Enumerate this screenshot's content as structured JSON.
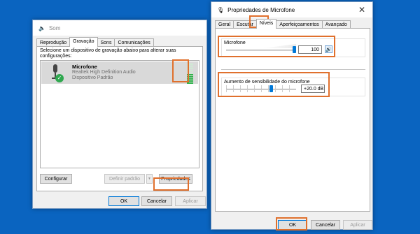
{
  "colors": {
    "desktop": "#0a64c0",
    "accent": "#0078d7",
    "highlight": "#e0702d",
    "meter_on": "#2fb34a"
  },
  "sound_window": {
    "title": "Som",
    "tabs": [
      {
        "label": "Reprodução"
      },
      {
        "label": "Gravação"
      },
      {
        "label": "Sons"
      },
      {
        "label": "Comunicações"
      }
    ],
    "selected_tab": "Gravação",
    "instruction": "Selecione um dispositivo de gravação abaixo para alterar suas configurações:",
    "device": {
      "name": "Microfone",
      "driver": "Realtek High Definition Audio",
      "status": "Dispositivo Padrão",
      "icon": "microphone-icon",
      "badge_icon": "checkmark-icon",
      "meter_level": 0.5
    },
    "buttons": {
      "configure": "Configurar",
      "set_default": "Definir padrão",
      "properties": "Propriedades",
      "ok": "OK",
      "cancel": "Cancelar",
      "apply": "Aplicar"
    }
  },
  "props_window": {
    "title": "Propriedades de Microfone",
    "tabs": [
      {
        "label": "Geral"
      },
      {
        "label": "Escutar"
      },
      {
        "label": "Níveis"
      },
      {
        "label": "Aperfeiçoamentos"
      },
      {
        "label": "Avançado"
      }
    ],
    "selected_tab": "Níveis",
    "microphone": {
      "label": "Microfone",
      "value": "100",
      "level": 1.0
    },
    "boost": {
      "label": "Aumento de sensibilidade do microfone",
      "value": "+20.0 dB",
      "level": 0.67
    },
    "buttons": {
      "ok": "OK",
      "cancel": "Cancelar",
      "apply": "Aplicar"
    }
  }
}
